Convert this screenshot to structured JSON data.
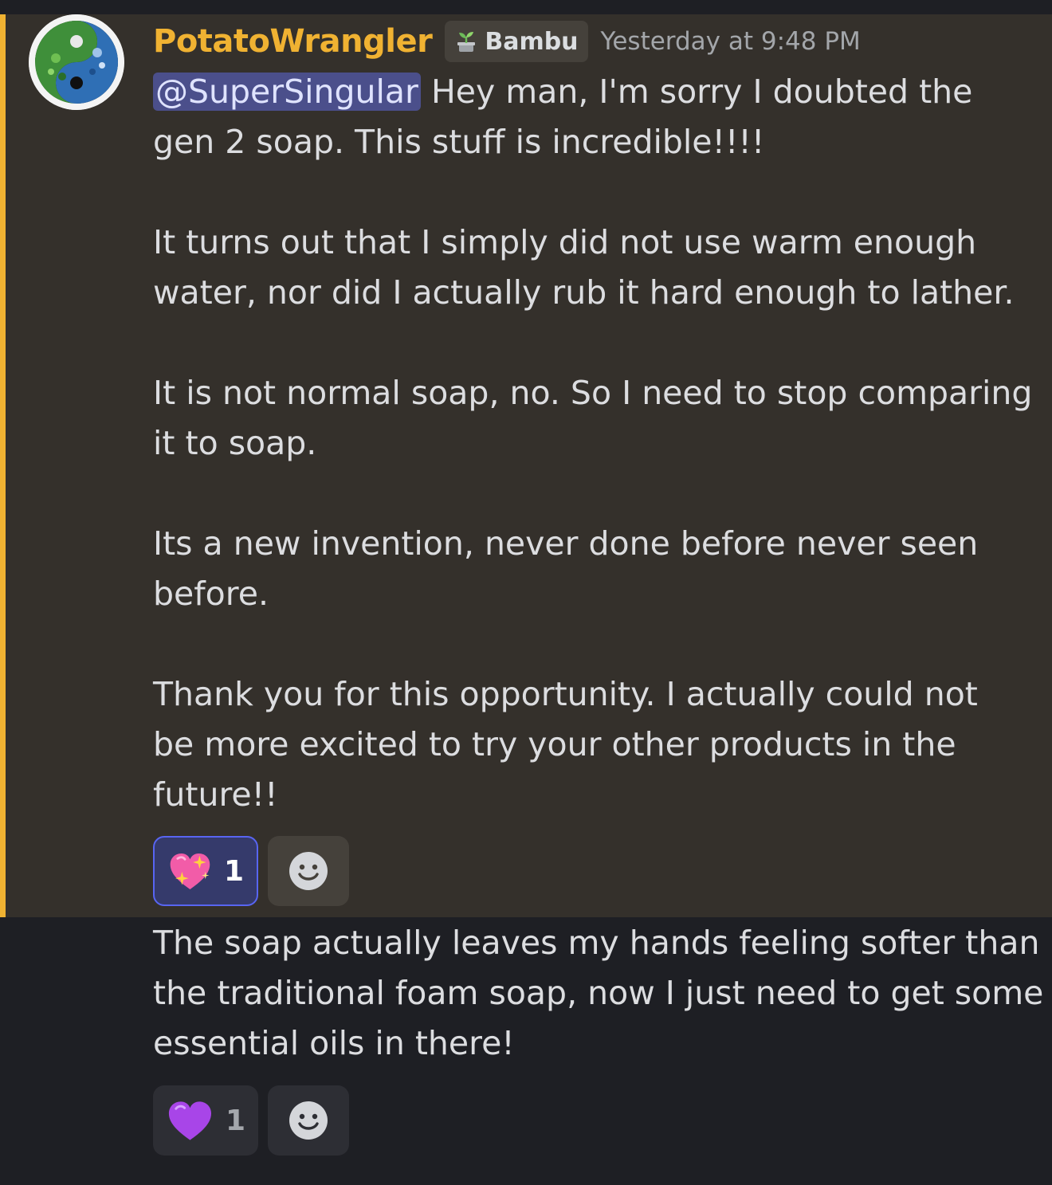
{
  "theme": {
    "accent": "#f0b232",
    "highlight_background": "#34302b",
    "page_background": "#1e1f24",
    "mention_background": "#4b4f8b",
    "active_reaction_border": "#5865f2"
  },
  "message1": {
    "author": {
      "username": "PotatoWrangler",
      "avatar_icon": "yin-yang-avatar-icon"
    },
    "tag": {
      "icon": "sprout-icon",
      "label": "Bambu"
    },
    "timestamp": "Yesterday at 9:48 PM",
    "mention": "@SuperSingular",
    "lines": [
      " Hey man, I'm sorry I doubted the",
      "gen 2 soap. This stuff is incredible!!!!",
      "",
      " It turns out that I simply did not use warm enough",
      "water, nor did I actually rub it hard enough to lather.",
      "",
      "It is not normal soap, no. So I need to stop comparing",
      "it to soap.",
      "",
      " Its a new invention, never done before never seen",
      "before.",
      "",
      "Thank you for this opportunity.  I actually could not",
      "be more excited to try your other products in the",
      "future!!"
    ],
    "reaction": {
      "emoji": "sparkling-heart-icon",
      "count": "1"
    },
    "add_reaction_icon": "smile-icon"
  },
  "message2": {
    "lines": [
      "The soap actually leaves my hands feeling softer than",
      "the traditional foam soap, now I just need to get some",
      "essential oils in there!"
    ],
    "reaction": {
      "emoji": "purple-heart-icon",
      "count": "1"
    },
    "add_reaction_icon": "smile-icon"
  }
}
